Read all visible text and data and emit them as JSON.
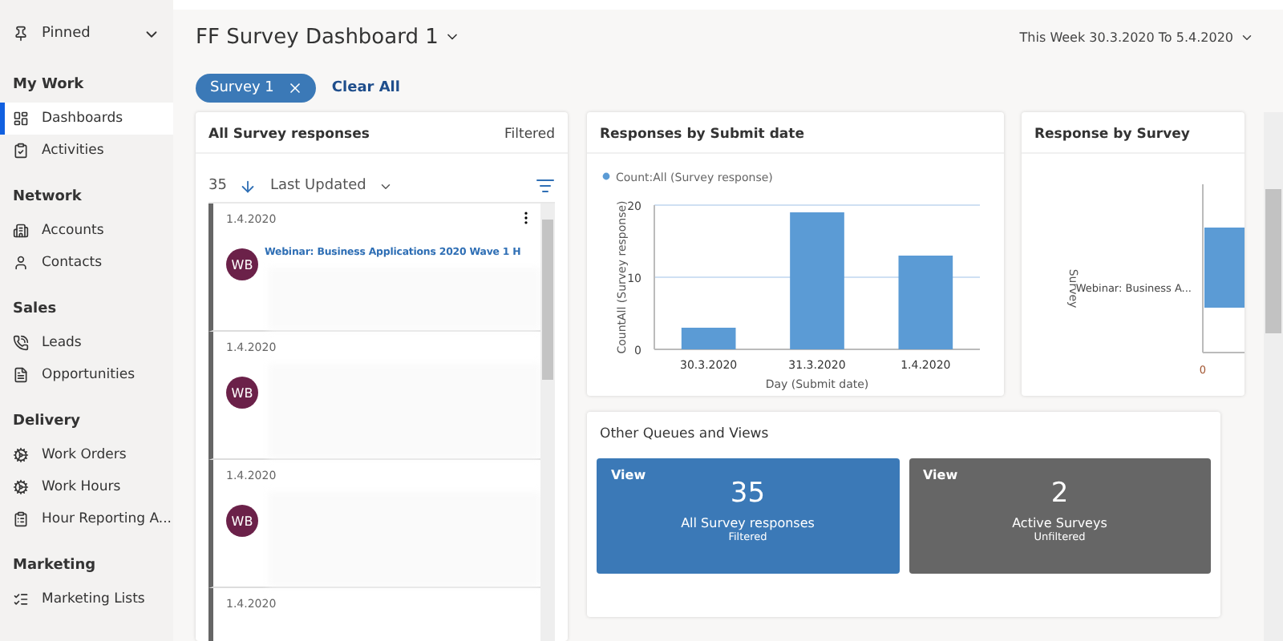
{
  "sidebar": {
    "pinned": {
      "label": "Pinned",
      "expanded": false
    },
    "groups": [
      {
        "title": "My Work",
        "items": [
          {
            "label": "Dashboards",
            "selected": true
          },
          {
            "label": "Activities",
            "selected": false
          }
        ]
      },
      {
        "title": "Network",
        "items": [
          {
            "label": "Accounts",
            "selected": false
          },
          {
            "label": "Contacts",
            "selected": false
          }
        ]
      },
      {
        "title": "Sales",
        "items": [
          {
            "label": "Leads",
            "selected": false
          },
          {
            "label": "Opportunities",
            "selected": false
          }
        ]
      },
      {
        "title": "Delivery",
        "items": [
          {
            "label": "Work Orders",
            "selected": false
          },
          {
            "label": "Work Hours",
            "selected": false
          },
          {
            "label": "Hour Reporting A...",
            "selected": false
          }
        ]
      },
      {
        "title": "Marketing",
        "items": [
          {
            "label": "Marketing Lists",
            "selected": false
          }
        ]
      }
    ]
  },
  "header": {
    "title": "FF Survey Dashboard 1",
    "date_range": "This Week 30.3.2020 To 5.4.2020"
  },
  "filters": {
    "chips": [
      "Survey 1"
    ],
    "clear": "Clear All"
  },
  "list_card": {
    "title": "All Survey responses",
    "status": "Filtered",
    "count": "35",
    "sort": "Last Updated",
    "records": [
      {
        "date": "1.4.2020",
        "initials": "WB",
        "title": "Webinar: Business Applications 2020 Wave 1 H"
      },
      {
        "date": "1.4.2020",
        "initials": "WB"
      },
      {
        "date": "1.4.2020",
        "initials": "WB"
      },
      {
        "date": "1.4.2020"
      }
    ]
  },
  "chart_card": {
    "title": "Responses by Submit date",
    "chart_data": {
      "type": "bar",
      "xlabel": "Day (Submit date)",
      "ylabel": "CountAll (Survey response)",
      "categories": [
        "30.3.2020",
        "31.3.2020",
        "1.4.2020"
      ],
      "series": [
        {
          "name": "Count:All (Survey response)",
          "color": "#5b9bd5",
          "values": [
            3,
            19,
            13
          ]
        }
      ],
      "ylim": [
        0,
        20
      ],
      "yticks": [
        0,
        10,
        20
      ]
    }
  },
  "survey_card": {
    "title": "Response by Survey",
    "ylabel": "Survey",
    "category": "Webinar: Business A...",
    "tick": "0"
  },
  "queues_card": {
    "title": "Other Queues and Views",
    "tiles": [
      {
        "label": "View",
        "count": "35",
        "name": "All Survey responses",
        "filter": "Filtered",
        "color": "#3b79b7"
      },
      {
        "label": "View",
        "count": "2",
        "name": "Active Surveys",
        "filter": "Unfiltered",
        "color": "#666666"
      }
    ]
  }
}
